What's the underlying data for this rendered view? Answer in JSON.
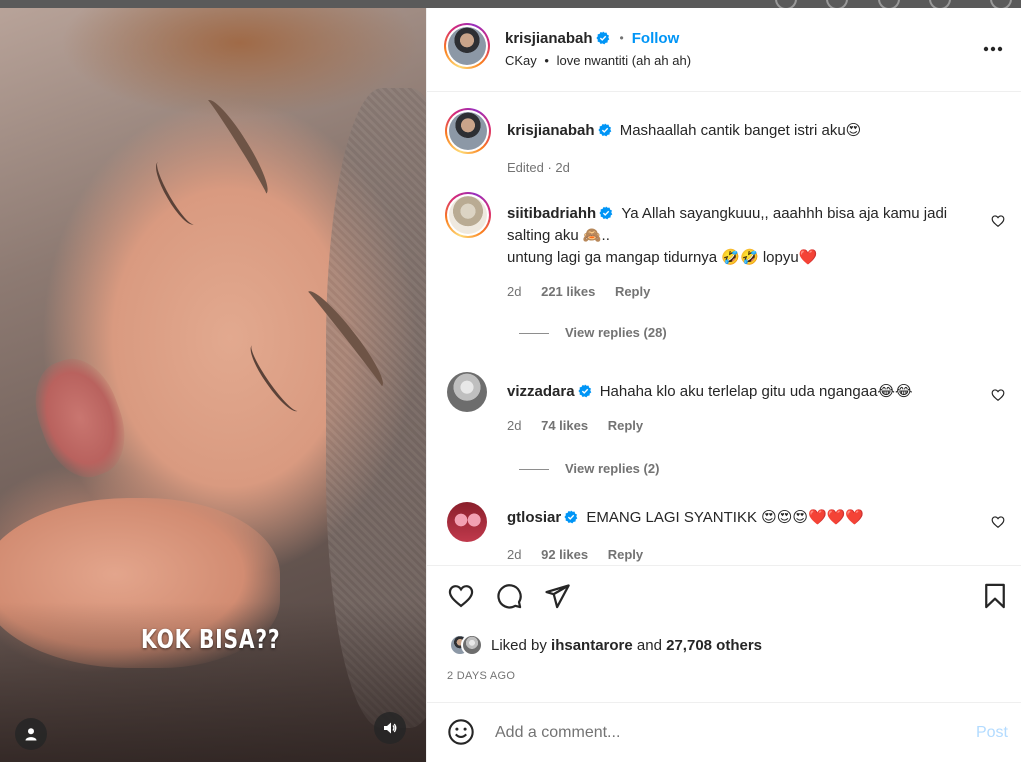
{
  "media": {
    "overlay_text": "KOK BISA??",
    "tag_icon": "user-tag-icon",
    "sound_icon": "speaker-icon"
  },
  "header": {
    "username": "krisjianabah",
    "separator": "•",
    "follow_label": "Follow",
    "audio_artist": "CKay",
    "audio_sep": "•",
    "audio_title": "love nwantiti (ah ah ah)",
    "more_icon": "more-horizontal-icon"
  },
  "caption": {
    "username": "krisjianabah",
    "text": "Mashaallah cantik banget istri aku😍",
    "meta": "Edited · 2d"
  },
  "comments": [
    {
      "username": "siitibadriahh",
      "text_line1": "Ya Allah sayangkuuu,, aaahhh bisa aja kamu jadi salting aku 🙈..",
      "text_line2": "untung lagi ga mangap tidurnya 🤣🤣 lopyu❤️",
      "time": "2d",
      "likes": "221 likes",
      "reply": "Reply",
      "view_replies": "View replies (28)"
    },
    {
      "username": "vizzadara",
      "text": "Hahaha klo aku terlelap gitu uda ngangaa😂😂",
      "time": "2d",
      "likes": "74 likes",
      "reply": "Reply",
      "view_replies": "View replies (2)"
    },
    {
      "username": "gtlosiar",
      "text": "EMANG LAGI SYANTIKK 😍😍😍❤️❤️❤️",
      "time": "2d",
      "likes": "92 likes",
      "reply": "Reply"
    }
  ],
  "actions": {
    "like_icon": "heart-icon",
    "comment_icon": "comment-icon",
    "share_icon": "send-icon",
    "save_icon": "bookmark-icon",
    "liked_prefix": "Liked by",
    "liked_user": "ihsantarore",
    "liked_and": "and",
    "liked_others": "27,708 others",
    "posted": "2 DAYS AGO"
  },
  "composer": {
    "placeholder": "Add a comment...",
    "post_label": "Post",
    "emoji_icon": "smiley-icon"
  },
  "colors": {
    "accent": "#0095f6",
    "post_disabled": "#b3dbff",
    "like_red": "#ed4956",
    "muted": "#737373"
  }
}
